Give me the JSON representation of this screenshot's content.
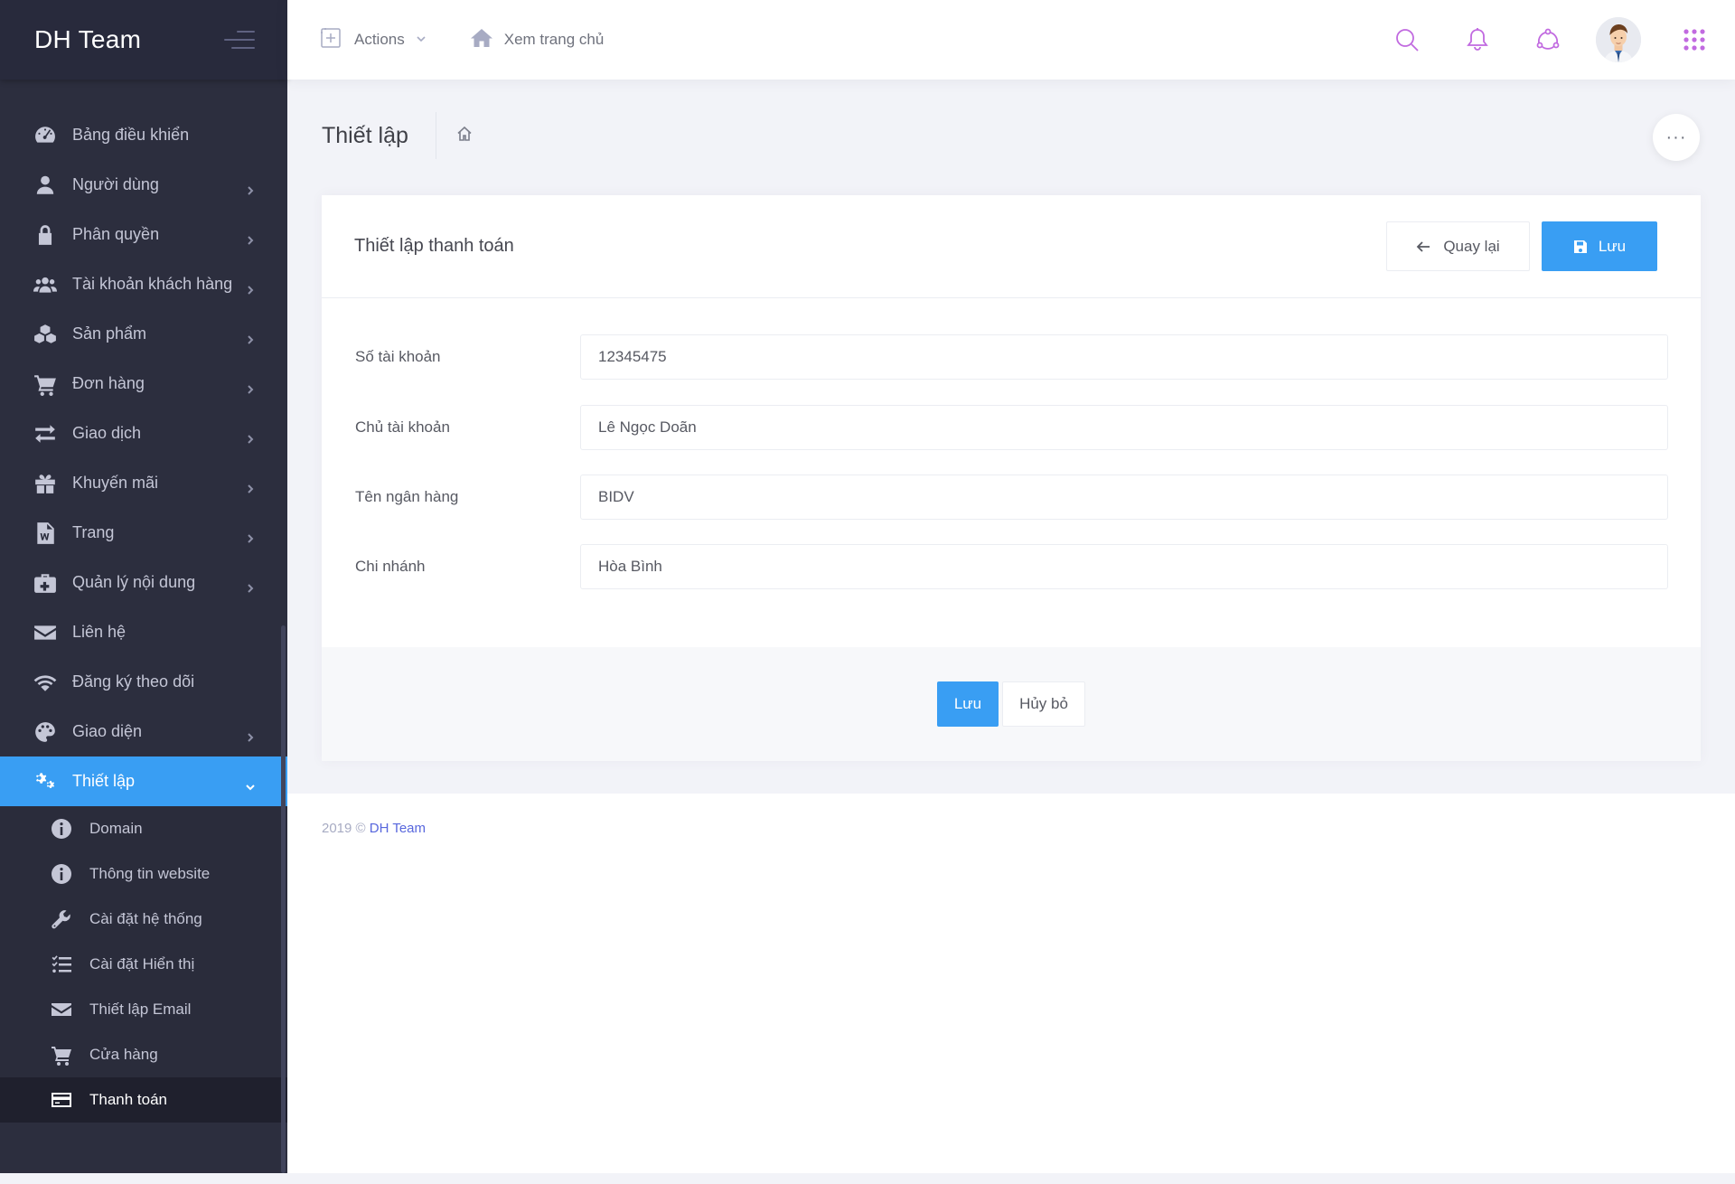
{
  "brand": {
    "name": "DH Team"
  },
  "header": {
    "actions_label": "Actions",
    "home_label": "Xem trang chủ"
  },
  "sidebar": {
    "items": [
      {
        "label": "Bảng điều khiển",
        "icon": "dashboard-icon",
        "has_children": false
      },
      {
        "label": "Người dùng",
        "icon": "user-icon",
        "has_children": true
      },
      {
        "label": "Phân quyền",
        "icon": "lock-icon",
        "has_children": true
      },
      {
        "label": "Tài khoản khách hàng",
        "icon": "users-icon",
        "has_children": true
      },
      {
        "label": "Sản phẩm",
        "icon": "cubes-icon",
        "has_children": true
      },
      {
        "label": "Đơn hàng",
        "icon": "cart-icon",
        "has_children": true
      },
      {
        "label": "Giao dịch",
        "icon": "exchange-icon",
        "has_children": true
      },
      {
        "label": "Khuyến mãi",
        "icon": "gift-icon",
        "has_children": true
      },
      {
        "label": "Trang",
        "icon": "file-word-icon",
        "has_children": true
      },
      {
        "label": "Quản lý nội dung",
        "icon": "medkit-icon",
        "has_children": true
      },
      {
        "label": "Liên hệ",
        "icon": "envelope-icon",
        "has_children": false
      },
      {
        "label": "Đăng ký theo dõi",
        "icon": "wifi-icon",
        "has_children": false
      },
      {
        "label": "Giao diện",
        "icon": "palette-icon",
        "has_children": true
      },
      {
        "label": "Thiết lập",
        "icon": "cogs-icon",
        "has_children": true,
        "active": true
      }
    ],
    "submenu": [
      {
        "label": "Domain",
        "icon": "info-circle-icon"
      },
      {
        "label": "Thông tin website",
        "icon": "info-circle-icon"
      },
      {
        "label": "Cài đặt hệ thống",
        "icon": "wrench-icon"
      },
      {
        "label": "Cài đặt Hiển thị",
        "icon": "tasks-icon"
      },
      {
        "label": "Thiết lập Email",
        "icon": "envelope-icon"
      },
      {
        "label": "Cửa hàng",
        "icon": "cart-icon"
      },
      {
        "label": "Thanh toán",
        "icon": "credit-card-icon",
        "current": true
      }
    ]
  },
  "page": {
    "title": "Thiết lập"
  },
  "portlet": {
    "title": "Thiết lập thanh toán",
    "back_label": "Quay lại",
    "save_label": "Lưu",
    "fields": [
      {
        "label": "Số tài khoản",
        "value": "12345475"
      },
      {
        "label": "Chủ tài khoản",
        "value": "Lê Ngọc Doãn"
      },
      {
        "label": "Tên ngân hàng",
        "value": "BIDV"
      },
      {
        "label": "Chi nhánh",
        "value": "Hòa Bình"
      }
    ],
    "footer_save_label": "Lưu",
    "footer_cancel_label": "Hủy bỏ"
  },
  "footer": {
    "copyright": "2019 ©",
    "link": "DH Team"
  },
  "colors": {
    "accent": "#399ef3",
    "sidebar_bg": "#2c2e3e",
    "header_icon": "#c16ae0",
    "link": "#5867dd"
  }
}
